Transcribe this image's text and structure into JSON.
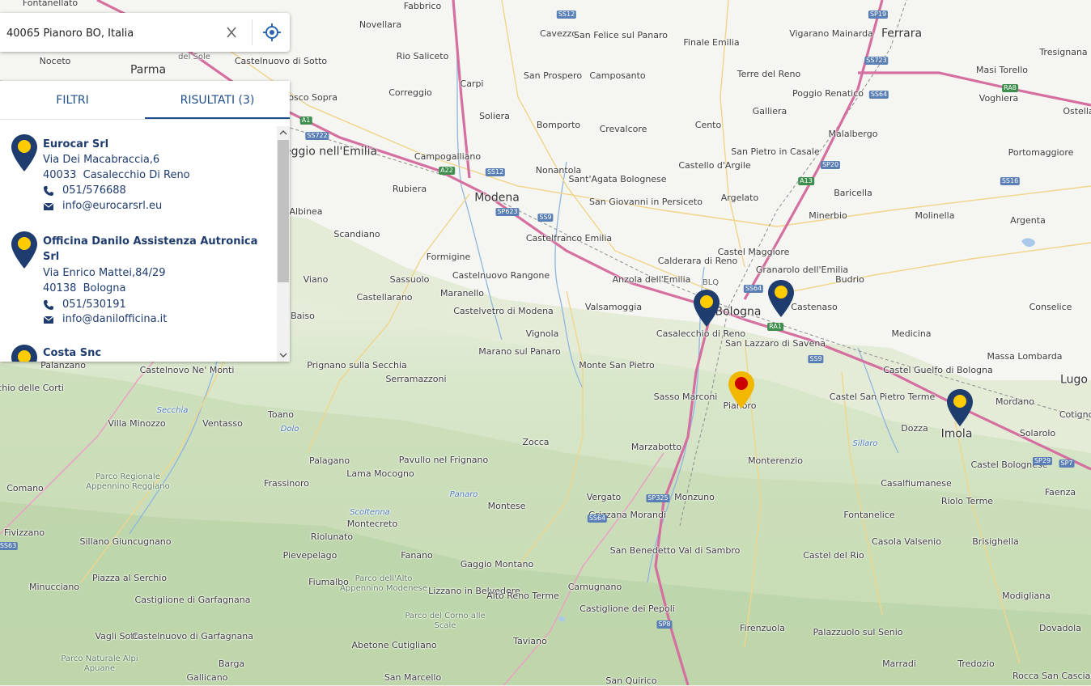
{
  "search": {
    "value": "40065 Pianoro BO, Italia"
  },
  "tabs": {
    "filters": "FILTRI",
    "results": "RISULTATI (3)"
  },
  "results": [
    {
      "name": "Eurocar Srl",
      "address": "Via Dei Macabraccia,6",
      "postal": "40033  Casalecchio Di Reno",
      "phone": "051/576688",
      "email": "info@eurocarsrl.eu"
    },
    {
      "name": "Officina Danilo Assistenza Autronica Srl",
      "address": "Via Enrico Mattei,84/29",
      "postal": "40138  Bologna",
      "phone": "051/530191",
      "email": "info@danilofficina.it"
    },
    {
      "name": "Costa Snc"
    }
  ],
  "colors": {
    "accent": "#1f4e8c",
    "pin_body": "#1f3c6e",
    "pin_dot": "#ffcc00",
    "origin_body": "#f2b800",
    "origin_dot": "#cc0000",
    "highway": "#d46fa0"
  },
  "icons": {
    "clear": "close-icon",
    "locate": "crosshair-icon",
    "phone": "phone-icon",
    "email": "envelope-icon",
    "pin": "map-pin-icon"
  },
  "map": {
    "majors": [
      "Parma",
      "Reggio nell'Emilia",
      "Modena",
      "Bologna",
      "Ferrara",
      "Imola",
      "Lugo"
    ],
    "towns": [
      "Fontanellato",
      "Fabbrico",
      "Novellara",
      "Cavezzo",
      "San Felice sul Panaro",
      "Finale Emilia",
      "Vigarano Mainarda",
      "Tresignana",
      "Noceto",
      "Castelnuovo di Sotto",
      "Rio Saliceto",
      "Masi Torello",
      "Carpi",
      "San Prospero",
      "Camposanto",
      "Terre del Reno",
      "Poggio Renatico",
      "Voghiera",
      "Correggio",
      "Bomporto",
      "Crevalcore",
      "Cento",
      "Galliera",
      "Malalbergo",
      "Soliera",
      "Ostellato",
      "Portomaggiore",
      "San Pietro in Casale",
      "Castello d'Argile",
      "Campogalliano",
      "Nonantola",
      "Sant'Agata Bolognese",
      "San Giovanni in Persiceto",
      "Argelato",
      "Baricella",
      "Rubiera",
      "Molinella",
      "Argenta",
      "Minerbio",
      "Scandiano",
      "Albinea",
      "Castelfranco Emilia",
      "Formigine",
      "Castel Maggiore",
      "Calderara di Reno",
      "Granarolo dell'Emilia",
      "Budrio",
      "Sassuolo",
      "Castelnuovo Rangone",
      "Viano",
      "Anzola dell'Emilia",
      "Maranello",
      "Castenaso",
      "Conselice",
      "Castellarano",
      "Castelvetro di Modena",
      "Valsamoggia",
      "Casalecchio di Reno",
      "Baiso",
      "Vignola",
      "San Lazzaro di Savena",
      "Medicina",
      "Marano sul Panaro",
      "Massa Lombarda",
      "Castelnovo Ne' Monti",
      "Prignano sulla Secchia",
      "Monte San Pietro",
      "Palanzano",
      "Castel Guelfo di Bologna",
      "Monchio delle Corti",
      "Serramazzoni",
      "Sasso Marconi",
      "Pianoro",
      "Castel San Pietro Terme",
      "Mordano",
      "Cotignola",
      "Toano",
      "Ventasso",
      "Villa Minozzo",
      "Zocca",
      "Dozza",
      "Solarolo",
      "Marzabotto",
      "Monterenzio",
      "Castel Bolognese",
      "Palagano",
      "Pavullo nel Frignano",
      "Lama Mocogno",
      "Frassinoro",
      "Comano",
      "Casalfiumanese",
      "Faenza",
      "Monzuno",
      "Vergato",
      "Montese",
      "Riolo Terme",
      "Grizzana Morandi",
      "Fontanelice",
      "Montecreto",
      "Fivizzano",
      "Sillano Giuncugnano",
      "Riolunato",
      "Casola Valsenio",
      "Brisighella",
      "San Benedetto Val di Sambro",
      "Pievepelago",
      "Fanano",
      "Castel del Rio",
      "Gaggio Montano",
      "Piazza al Serchio",
      "Minucciano",
      "Fiumalbo",
      "Lizzano in Belvedere",
      "Camugnano",
      "Alto Reno Terme",
      "Castiglione di Garfagnana",
      "Castiglione dei Pepoli",
      "Modigliana",
      "Firenzuola",
      "Vagli Sotto",
      "Castelnuovo di Garfagnana",
      "Palazzuolo sul Senio",
      "Dovadola",
      "Abetone Cutigliano",
      "Taviano",
      "Barga",
      "Marradi",
      "Tredozio",
      "Gallicano",
      "San Marcello",
      "San Quirico",
      "Rocca San Casciano",
      "Gelbosco Sopra"
    ],
    "water": [
      "Secchia",
      "Dolo",
      "Panaro",
      "Scoltenna",
      "Sillaro"
    ],
    "parks": [
      "Parco Regionale Appennino Reggiano",
      "Parco dell'Alto Appennino Modenese",
      "Parco del Corno alle Scale",
      "Parco Naturale Alpi Apuane"
    ],
    "roads": [
      "SS12",
      "SP19",
      "SS723",
      "SS64",
      "A1",
      "SS722",
      "A22",
      "SS12",
      "SP623",
      "SS9",
      "A13",
      "SP20",
      "RA8",
      "SS16",
      "SP29",
      "SP7",
      "SS64",
      "SP325",
      "SS9",
      "RA1",
      "SS64",
      "SP8",
      "SS63",
      "del Sole",
      "BLQ"
    ]
  }
}
